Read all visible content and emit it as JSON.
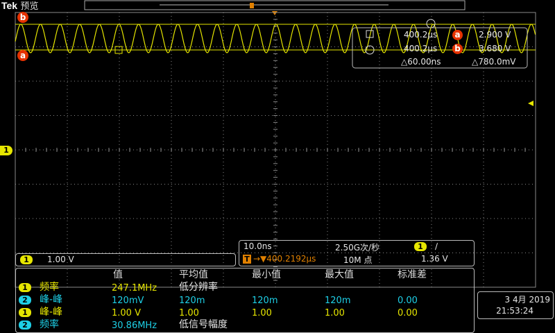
{
  "brand": {
    "logo": "Tek",
    "mode": "预览"
  },
  "colors": {
    "ch1": "#e6e600",
    "ch2": "#1ecfe6",
    "cursor_marker": "#e63200",
    "grid": "#8a8a8a"
  },
  "cursor_readout": {
    "t1": "400.2μs",
    "v1": "2.900 V",
    "t2": "400.2μs",
    "v2": "3.680 V",
    "dt": "△60.00ns",
    "dv": "△780.0mV",
    "marker_a": "a",
    "marker_b": "b"
  },
  "channel_marker": "1",
  "ch1_scale": {
    "badge": "1",
    "value": "1.00 V"
  },
  "timebase": {
    "horizontal_scale": "10.0ns",
    "sample_rate": "2.50G次/秒",
    "trigger_channel": "1",
    "trigger_slope": "∕",
    "trigger_icon": "T",
    "position": "→▼400.2192μs",
    "record_length": "10M 点",
    "trigger_level": "1.36 V"
  },
  "measurements": {
    "headers": [
      "值",
      "平均值",
      "最小值",
      "最大值",
      "标准差"
    ],
    "rows": [
      {
        "ch": "1",
        "name": "频率",
        "value": "247.1MHz",
        "mean": "低分辨率",
        "min": "",
        "max": "",
        "std": ""
      },
      {
        "ch": "2",
        "name": "峰-峰",
        "value": "120mV",
        "mean": "120m",
        "min": "120m",
        "max": "120m",
        "std": "0.00"
      },
      {
        "ch": "1",
        "name": "峰-峰",
        "value": "1.00 V",
        "mean": "1.00",
        "min": "1.00",
        "max": "1.00",
        "std": "0.00"
      },
      {
        "ch": "2",
        "name": "频率",
        "value": "30.86MHz",
        "mean": "低信号幅度",
        "min": "",
        "max": "",
        "std": ""
      }
    ]
  },
  "datetime": {
    "date": "3 4月 2019",
    "time": "21:53:24"
  }
}
